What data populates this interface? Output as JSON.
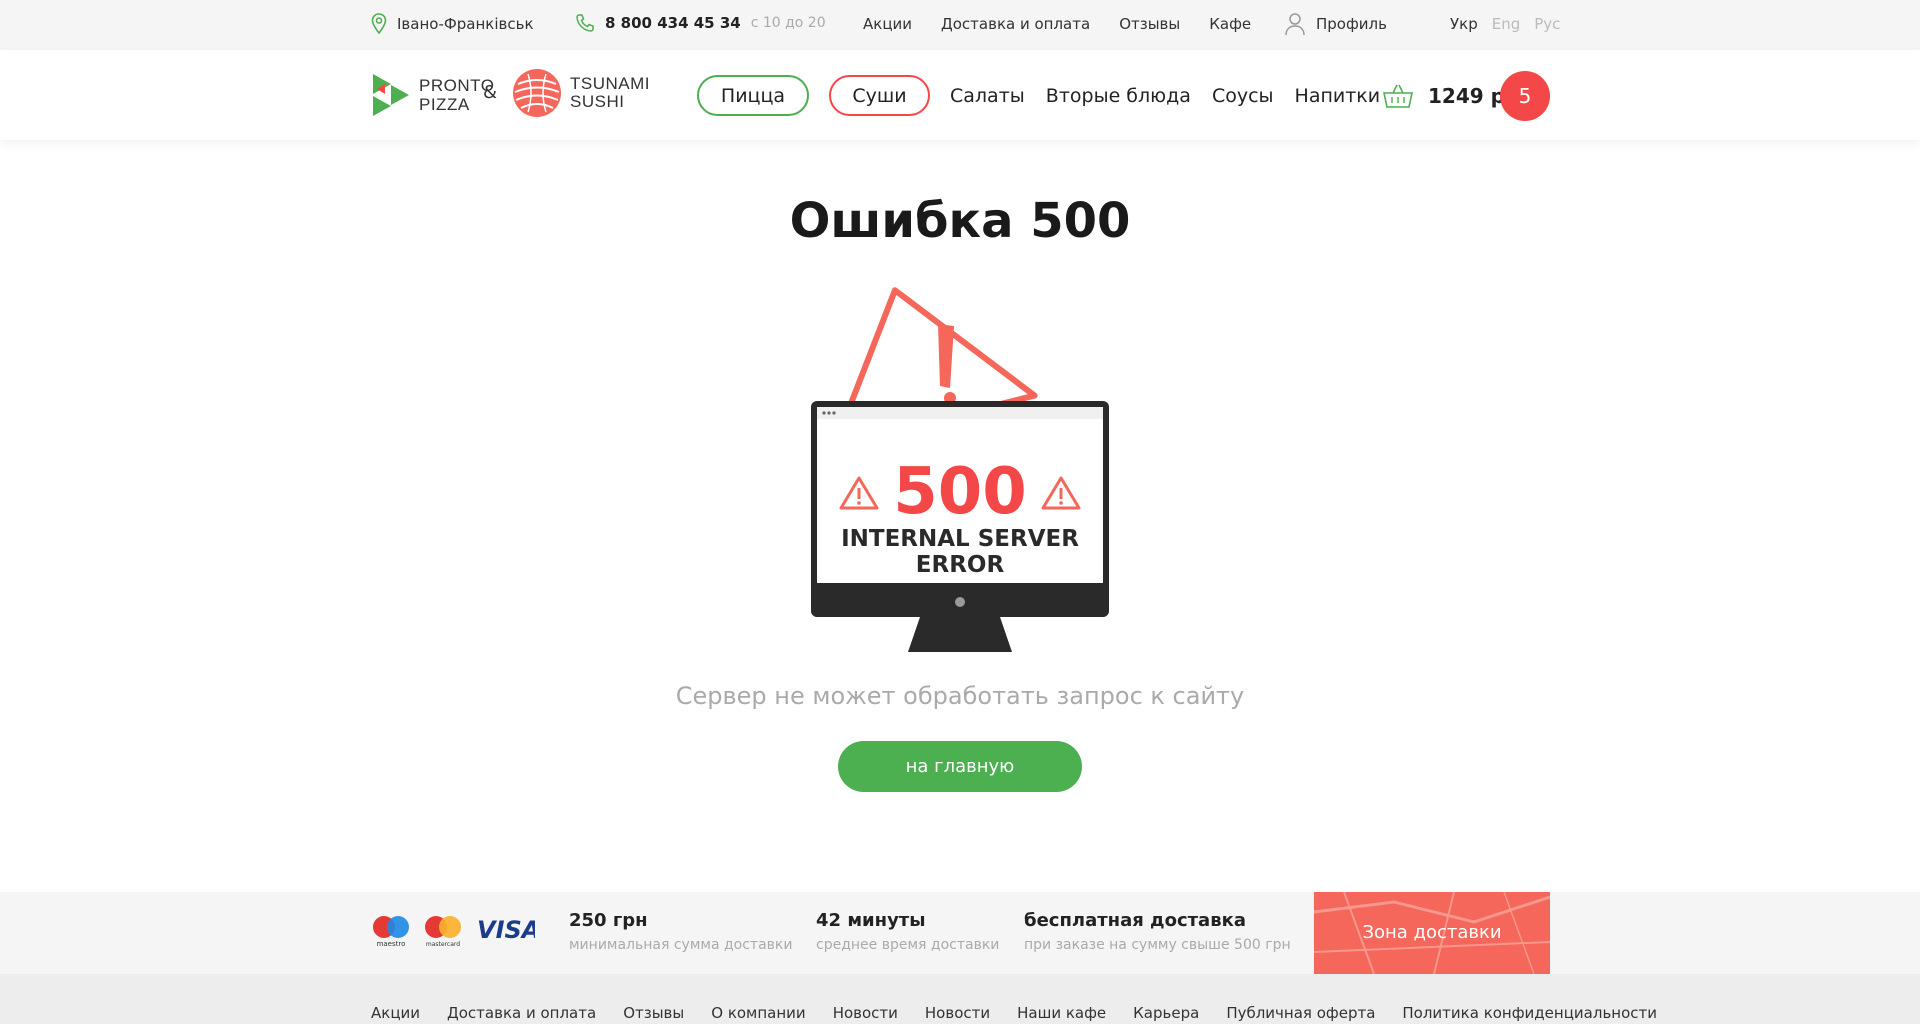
{
  "topbar": {
    "city": "Івано-Франківськ",
    "phone": "8 800 434 45 34",
    "hours": "с 10 до 20",
    "nav": [
      "Акции",
      "Доставка и оплата",
      "Отзывы",
      "Кафе"
    ],
    "profile": "Профиль",
    "languages": [
      "Укр",
      "Eng",
      "Рус"
    ]
  },
  "header": {
    "logo_pronto": [
      "PRONTO",
      "PIZZA"
    ],
    "amp": "&",
    "logo_tsunami": [
      "TSUNAMI",
      "SUSHI"
    ],
    "categories_pill": [
      "Пицца",
      "Суши"
    ],
    "categories": [
      "Салаты",
      "Вторые блюда",
      "Соусы",
      "Напитки"
    ],
    "cart_total": "1249 р",
    "cart_count": "5"
  },
  "main": {
    "title": "Ошибка 500",
    "illustration": {
      "code": "500",
      "line1": "INTERNAL SERVER",
      "line2": "ERROR"
    },
    "subtitle": "Сервер не может обработать запрос к сайту",
    "home_button": "на главную"
  },
  "footer_info": {
    "payment_labels": [
      "maestro",
      "mastercard",
      "VISA"
    ],
    "stats": [
      {
        "value": "250 грн",
        "label": "минимальная сумма доставки"
      },
      {
        "value": "42 минуты",
        "label": "среднее время доставки"
      },
      {
        "value": "бесплатная доставка",
        "label": "при заказе на сумму свыше 500 грн"
      }
    ],
    "zone": "Зона доставки"
  },
  "footer_nav": [
    "Акции",
    "Доставка и оплата",
    "Отзывы",
    "О компании",
    "Новости",
    "Новости",
    "Наши кафе",
    "Карьера",
    "Публичная оферта",
    "Политика конфиденциальности"
  ],
  "colors": {
    "green": "#4caf50",
    "red": "#f44747",
    "salmon": "#f4675a"
  }
}
